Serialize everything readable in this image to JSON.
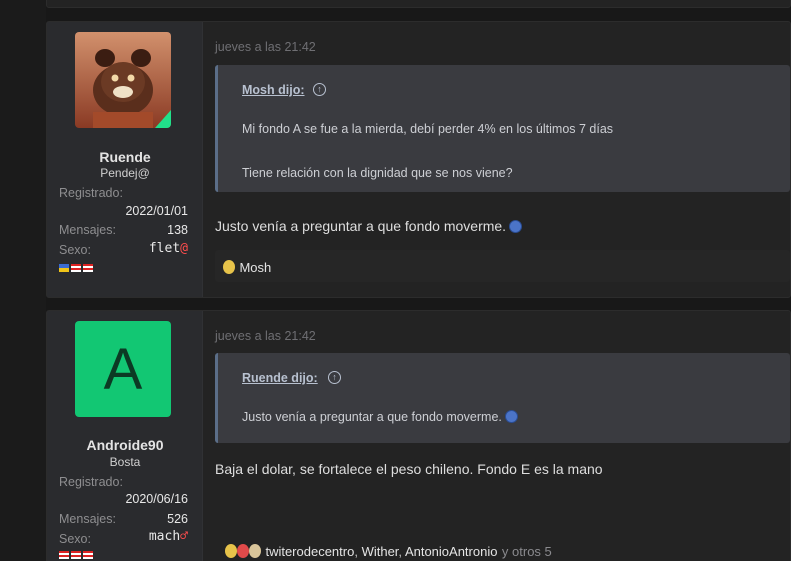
{
  "posts": [
    {
      "user": {
        "name": "Ruende",
        "title": "Pendej@",
        "registered_label": "Registrado:",
        "registered_value": "2022/01/01",
        "messages_label": "Mensajes:",
        "messages_value": "138",
        "sex_label": "Sexo:",
        "sex_value": "flet",
        "sex_symbol": "@"
      },
      "date": "jueves a las 21:42",
      "quote": {
        "author": "Mosh dijo:",
        "lines": [
          "Mi fondo A se fue a la mierda, debí perder 4% en los últimos 7 días",
          "Tiene relación con la dignidad que se nos viene?"
        ]
      },
      "body": "Justo venía a preguntar a que fondo moverme.",
      "reactions": {
        "users": "Mosh"
      }
    },
    {
      "user": {
        "avatar_letter": "A",
        "name": "Androide90",
        "title": "Bosta",
        "registered_label": "Registrado:",
        "registered_value": "2020/06/16",
        "messages_label": "Mensajes:",
        "messages_value": "526",
        "sex_label": "Sexo:",
        "sex_value": "mach",
        "sex_symbol": "♂"
      },
      "date": "jueves a las 21:42",
      "quote": {
        "author": "Ruende dijo:",
        "lines": [
          "Justo venía a preguntar a que fondo moverme."
        ]
      },
      "body": "Baja el dolar, se fortalece el peso chileno. Fondo E es la mano",
      "reactions": {
        "user1": "twiterodecentro",
        "user2": "Wither",
        "user3": "AntonioAntronio",
        "more": "y otros 5"
      }
    }
  ],
  "colors": {
    "background": "#181818",
    "post_bg": "#232323",
    "user_cell_bg": "#2a2b2e",
    "quote_bg": "#3a3b40",
    "avatar_green": "#12c773"
  }
}
